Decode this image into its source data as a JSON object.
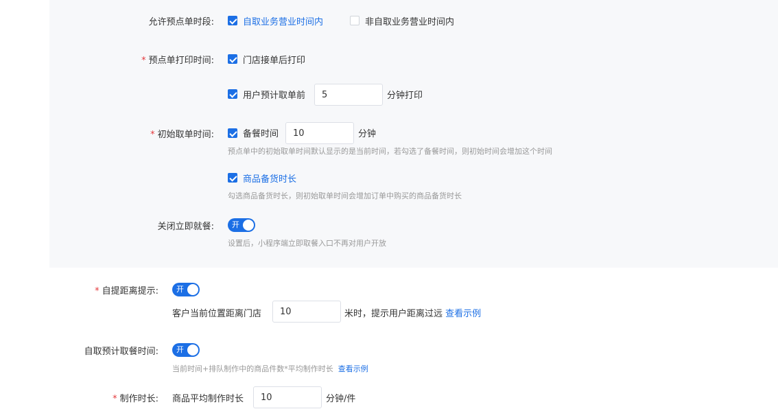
{
  "colors": {
    "accent": "#1c6fe5",
    "required": "#e4393c",
    "hint": "#999999",
    "panel_bg": "#f7f8fa"
  },
  "preorder_period": {
    "label": "允许预点单时段:",
    "opt_within": {
      "label": "自取业务营业时间内",
      "checked": true
    },
    "opt_outside": {
      "label": "非自取业务营业时间内",
      "checked": false
    }
  },
  "print_time": {
    "label": "预点单打印时间:",
    "opt_store": {
      "label": "门店接单后打印",
      "checked": true
    },
    "opt_before": {
      "label": "用户预计取单前",
      "checked": true,
      "value": "5",
      "suffix": "分钟打印"
    }
  },
  "initial_pickup": {
    "label": "初始取单时间:",
    "opt_prep": {
      "label": "备餐时间",
      "checked": true,
      "value": "10",
      "suffix": "分钟"
    },
    "prep_hint": "预点单中的初始取单时间默认显示的是当前时间，若勾选了备餐时间，则初始时间会增加这个时间",
    "opt_goods": {
      "label": "商品备货时长",
      "checked": true
    },
    "goods_hint": "勾选商品备货时长，则初始取单时间会增加订单中购买的商品备货时长"
  },
  "close_dine": {
    "label": "关闭立即就餐:",
    "toggle_text": "开",
    "toggle_on": true,
    "hint": "设置后，小程序端立即取餐入口不再对用户开放"
  },
  "distance_tip": {
    "label": "自提距离提示:",
    "toggle_text": "开",
    "toggle_on": true,
    "prefix": "客户当前位置距离门店",
    "value": "10",
    "suffix": "米时，提示用户距离过远",
    "link": "查看示例"
  },
  "est_pickup": {
    "label": "自取预计取餐时间:",
    "toggle_text": "开",
    "toggle_on": true,
    "hint": "当前时间+排队制作中的商品件数*平均制作时长",
    "link": "查看示例"
  },
  "make_time": {
    "label": "制作时长:",
    "prefix": "商品平均制作时长",
    "value": "10",
    "suffix": "分钟/件"
  }
}
